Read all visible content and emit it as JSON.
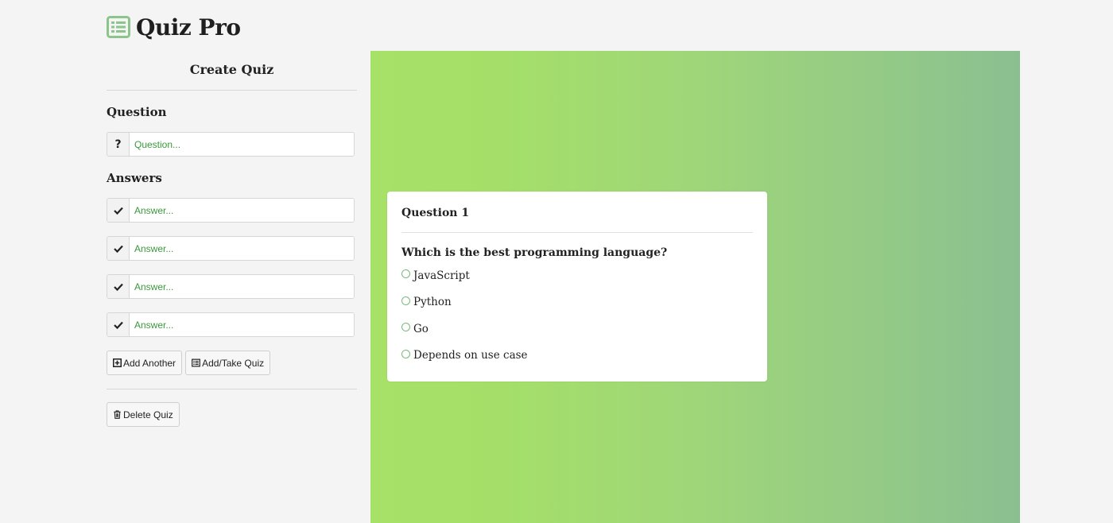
{
  "app": {
    "title": "Quiz Pro",
    "logo_icon": "list-alt-icon",
    "accent_color": "#5aa85a"
  },
  "create_panel": {
    "title": "Create Quiz",
    "question_label": "Question",
    "question_placeholder": "Question...",
    "question_icon": "question-mark-icon",
    "answers_label": "Answers",
    "answer_icon": "check-icon",
    "answers": [
      {
        "placeholder": "Answer...",
        "value": ""
      },
      {
        "placeholder": "Answer...",
        "value": ""
      },
      {
        "placeholder": "Answer...",
        "value": ""
      },
      {
        "placeholder": "Answer...",
        "value": ""
      }
    ],
    "add_another_label": "Add Another",
    "add_another_icon": "plus-square-icon",
    "add_take_label": "Add/Take Quiz",
    "add_take_icon": "list-icon",
    "delete_label": "Delete Quiz",
    "delete_icon": "trash-icon"
  },
  "quiz_card": {
    "title": "Question 1",
    "question": "Which is the best programming language?",
    "options": [
      "JavaScript",
      "Python",
      "Go",
      "Depends on use case"
    ]
  },
  "stage": {
    "gradient_start": "#a7e167",
    "gradient_end": "#8bbf91"
  }
}
